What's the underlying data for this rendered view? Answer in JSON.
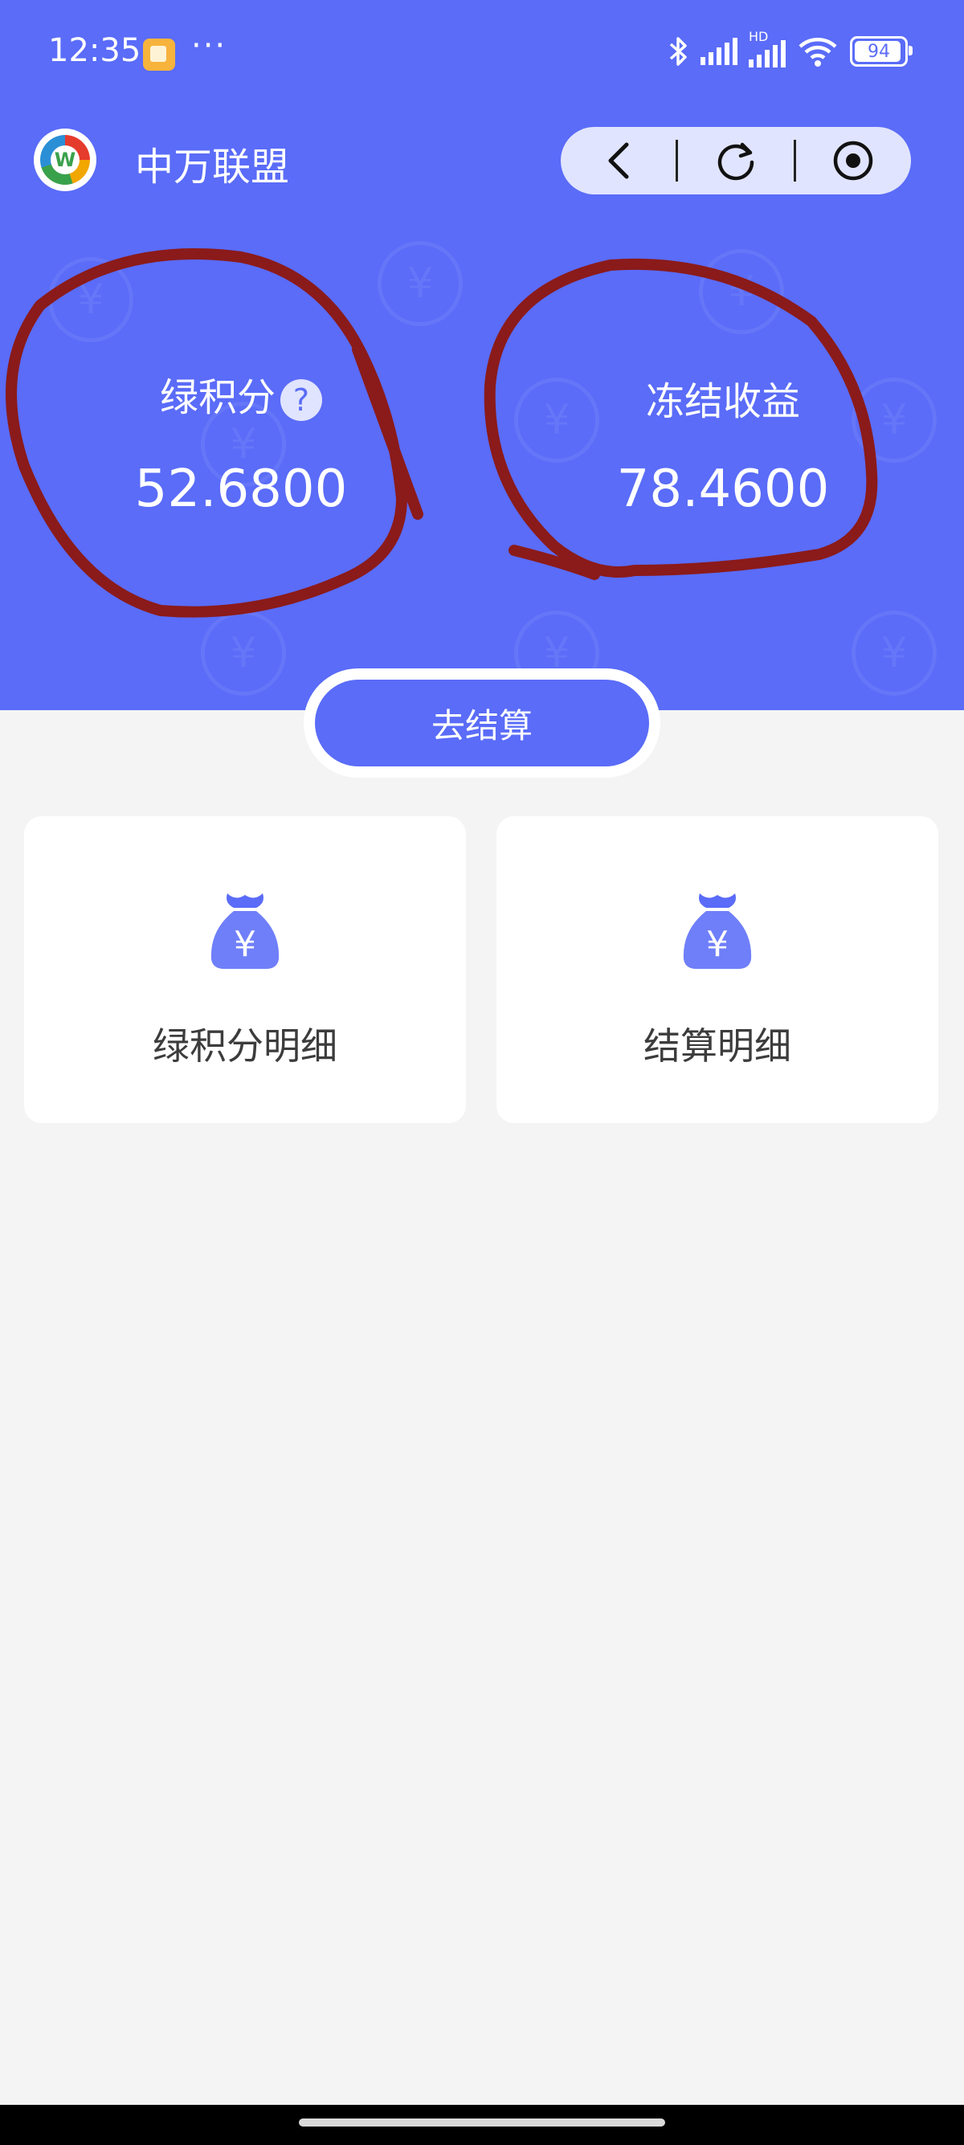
{
  "status_bar": {
    "time": "12:35",
    "dots": "···",
    "hd_label": "HD",
    "battery": "94"
  },
  "app_bar": {
    "logo_letter": "W",
    "title": "中万联盟"
  },
  "stats": {
    "green_points": {
      "label": "绿积分",
      "help": "?",
      "value": "52.6800"
    },
    "frozen_income": {
      "label": "冻结收益",
      "value": "78.4600"
    }
  },
  "settle_button": "去结算",
  "cards": [
    {
      "label": "绿积分明细",
      "icon_char": "¥"
    },
    {
      "label": "结算明细",
      "icon_char": "¥"
    }
  ],
  "colors": {
    "primary": "#5a6cf8",
    "background": "#f4f4f4",
    "annotation": "#8b1a1a"
  },
  "icons": [
    "bluetooth-icon",
    "signal-icon",
    "wifi-icon",
    "battery-icon",
    "back-icon",
    "refresh-icon",
    "record-icon",
    "help-icon",
    "money-bag-icon"
  ]
}
